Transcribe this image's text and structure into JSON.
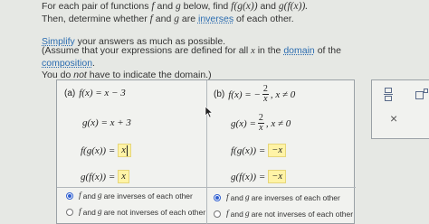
{
  "intro": {
    "line1_a": "For each pair of functions ",
    "line1_f": "f",
    "line1_b": " and ",
    "line1_g": "g",
    "line1_c": " below, find ",
    "line1_fg": "f(g(x))",
    "line1_d": " and ",
    "line1_gf": "g(f(x)).",
    "line2_a": "Then, determine whether ",
    "line2_b": " and ",
    "line2_c": " are ",
    "line2_link": "inverses",
    "line2_d": " of each other."
  },
  "simplify": {
    "link": "Simplify",
    "rest": " your answers as much as possible."
  },
  "assume": {
    "a": "(Assume that your expressions are defined for all ",
    "x": "x",
    "b": " in the ",
    "link1": "domain",
    "c": " of the ",
    "link2": "composition",
    "d": ".",
    "e": "You do ",
    "not": "not",
    "f": " have to indicate the domain.)"
  },
  "part_a": {
    "label": "(a)",
    "f_def": "f(x) = x − 3",
    "g_def": "g(x) = x + 3",
    "fg_lhs": "f(g(x)) =",
    "fg_answer": "x",
    "gf_lhs": "g(f(x)) =",
    "gf_answer": "x",
    "options": [
      {
        "pre": "",
        "f": "f",
        "mid": " and ",
        "g": "g",
        "post": " are inverses of each other",
        "selected": true
      },
      {
        "pre": "",
        "f": "f",
        "mid": " and ",
        "g": "g",
        "post": " are not inverses of each other",
        "selected": false
      }
    ]
  },
  "part_b": {
    "label": "(b)",
    "f_lhs": "f(x) = −",
    "f_num": "2",
    "f_den": "x",
    "f_cond": ", x ≠ 0",
    "g_lhs": "g(x) =",
    "g_num": "2",
    "g_den": "x",
    "g_cond": ", x ≠ 0",
    "fg_lhs": "f(g(x)) =",
    "fg_answer": "−x",
    "gf_lhs": "g(f(x)) =",
    "gf_answer": "−x",
    "options": [
      {
        "f": "f",
        "mid": " and ",
        "g": "g",
        "post": " are inverses of each other",
        "selected": true
      },
      {
        "f": "f",
        "mid": " and ",
        "g": "g",
        "post": " are not inverses of each other",
        "selected": false
      }
    ]
  },
  "toolbar": {
    "close_symbol": "×"
  }
}
